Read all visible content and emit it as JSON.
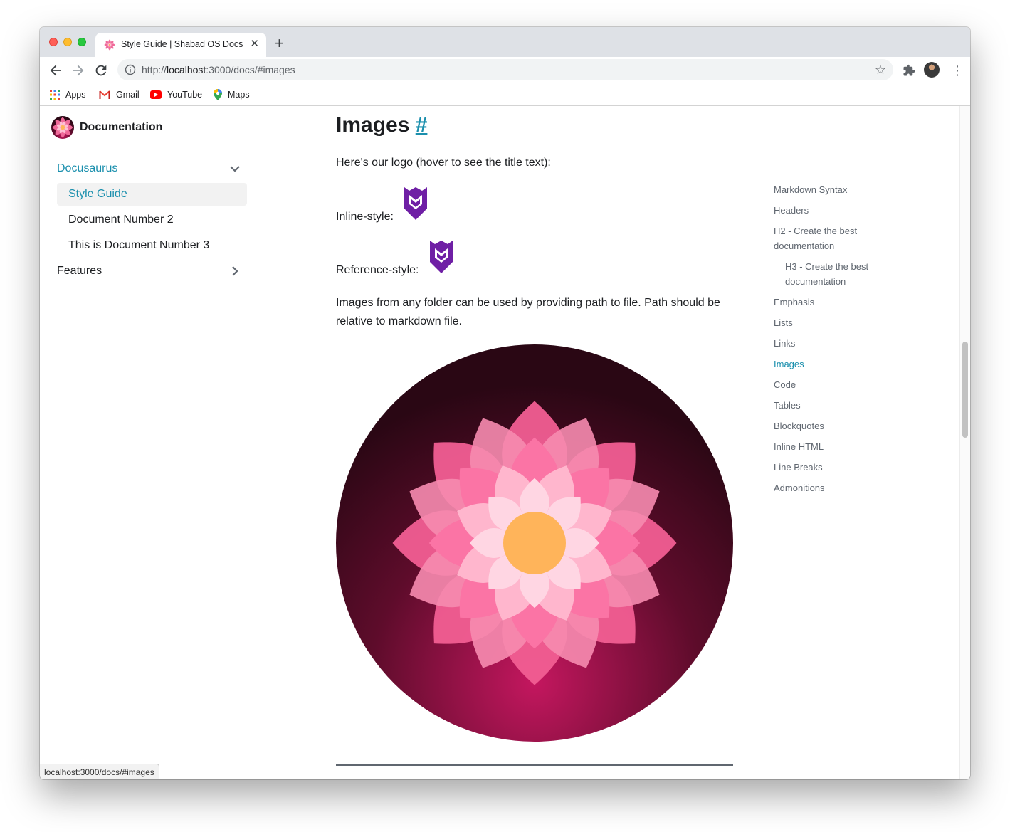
{
  "browser": {
    "tab_title": "Style Guide | Shabad OS Docs",
    "url_scheme": "http://",
    "url_host": "localhost",
    "url_rest": ":3000/docs/#images",
    "bookmarks": [
      "Apps",
      "Gmail",
      "YouTube",
      "Maps"
    ],
    "status_url": "localhost:3000/docs/#images"
  },
  "sidebar": {
    "brand": "Documentation",
    "categories": [
      {
        "label": "Docusaurus",
        "expanded": true
      },
      {
        "label": "Features",
        "expanded": false
      }
    ],
    "items": [
      {
        "label": "Style Guide",
        "active": true
      },
      {
        "label": "Document Number 2",
        "active": false
      },
      {
        "label": "This is Document Number 3",
        "active": false
      }
    ]
  },
  "content": {
    "heading": "Images",
    "heading_anchor": "#",
    "intro": "Here's our logo (hover to see the title text):",
    "inline_label": "Inline-style:",
    "reference_label": "Reference-style:",
    "paragraph": "Images from any folder can be used by providing path to file. Path should be relative to markdown file."
  },
  "toc": [
    {
      "label": "Markdown Syntax"
    },
    {
      "label": "Headers"
    },
    {
      "label": "H2 - Create the best documentation"
    },
    {
      "label": "H3 - Create the best documentation",
      "sub": true
    },
    {
      "label": "Emphasis"
    },
    {
      "label": "Lists"
    },
    {
      "label": "Links"
    },
    {
      "label": "Images",
      "active": true
    },
    {
      "label": "Code"
    },
    {
      "label": "Tables"
    },
    {
      "label": "Blockquotes"
    },
    {
      "label": "Inline HTML"
    },
    {
      "label": "Line Breaks"
    },
    {
      "label": "Admonitions"
    }
  ],
  "colors": {
    "accent": "#1a8fad",
    "logo_purple": "#6f1fa5",
    "lotus_center": "#ffb45a"
  }
}
